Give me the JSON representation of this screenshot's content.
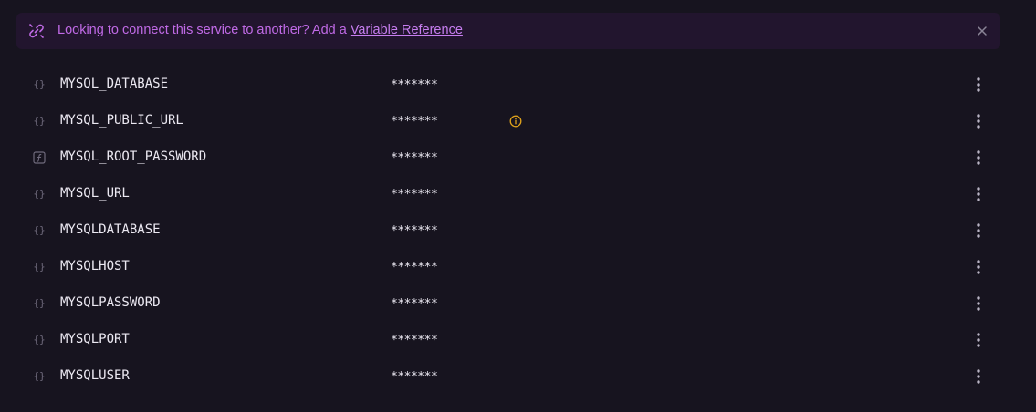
{
  "banner": {
    "text": "Looking to connect this service to another? Add a ",
    "link_label": "Variable Reference",
    "icon": "link-chain-icon",
    "close_icon": "close-icon"
  },
  "colors": {
    "background": "#17141f",
    "banner_bg": "#22152e",
    "accent": "#c06ae6",
    "warning": "#e0a21b"
  },
  "variables": [
    {
      "name": "MYSQL_DATABASE",
      "value": "*******",
      "type_icon": "braces-icon",
      "warning": false
    },
    {
      "name": "MYSQL_PUBLIC_URL",
      "value": "*******",
      "type_icon": "braces-icon",
      "warning": true
    },
    {
      "name": "MYSQL_ROOT_PASSWORD",
      "value": "*******",
      "type_icon": "function-icon",
      "warning": false
    },
    {
      "name": "MYSQL_URL",
      "value": "*******",
      "type_icon": "braces-icon",
      "warning": false
    },
    {
      "name": "MYSQLDATABASE",
      "value": "*******",
      "type_icon": "braces-icon",
      "warning": false
    },
    {
      "name": "MYSQLHOST",
      "value": "*******",
      "type_icon": "braces-icon",
      "warning": false
    },
    {
      "name": "MYSQLPASSWORD",
      "value": "*******",
      "type_icon": "braces-icon",
      "warning": false
    },
    {
      "name": "MYSQLPORT",
      "value": "*******",
      "type_icon": "braces-icon",
      "warning": false
    },
    {
      "name": "MYSQLUSER",
      "value": "*******",
      "type_icon": "braces-icon",
      "warning": false
    }
  ]
}
